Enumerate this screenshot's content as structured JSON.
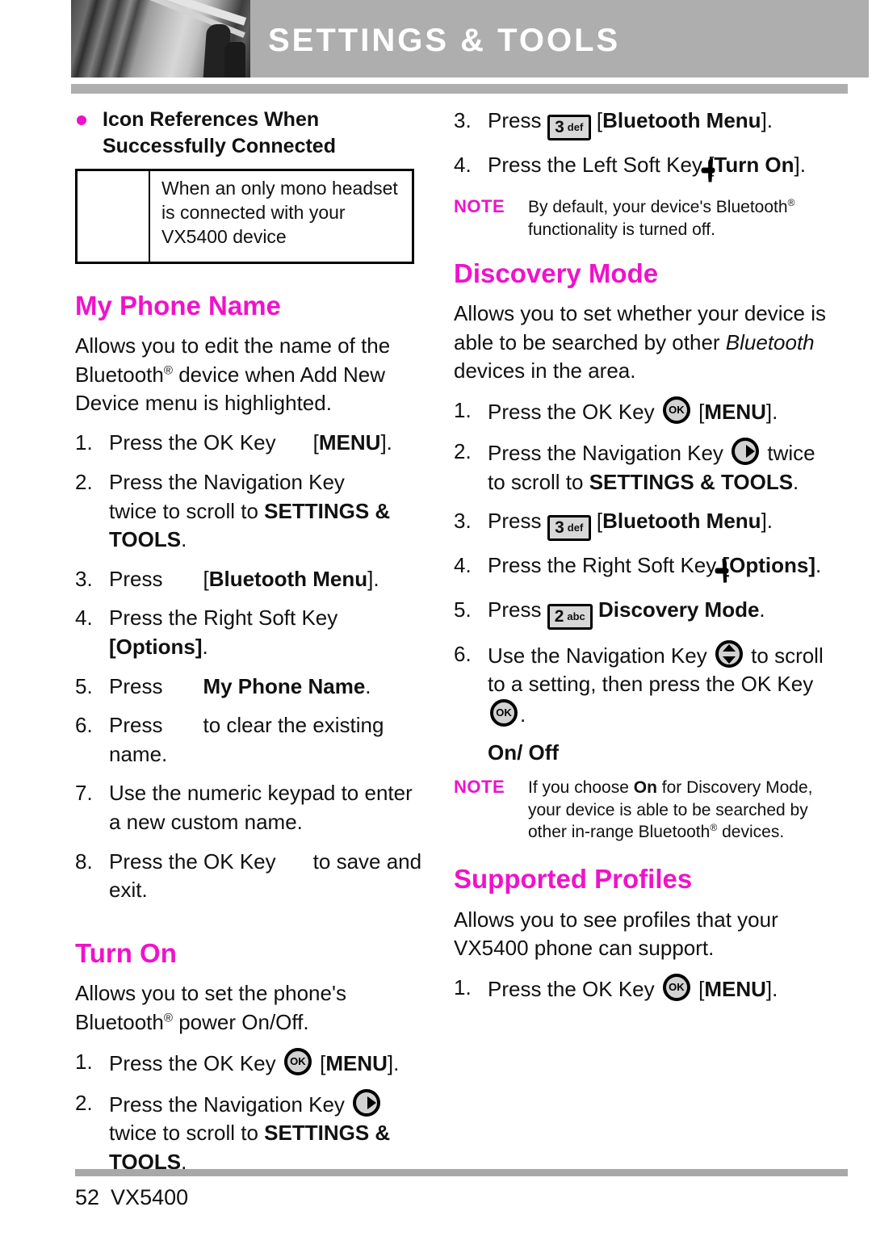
{
  "header": {
    "title": "SETTINGS & TOOLS",
    "photo_alt": "grayscale-architecture-photo"
  },
  "left_column": {
    "icon_ref": {
      "heading_line1": "Icon References When",
      "heading_line2": "Successfully Connected",
      "table": {
        "icon_cell": "",
        "description": "When an only mono headset is connected with your VX5400 device"
      }
    },
    "my_phone_name": {
      "title": "My Phone Name",
      "description": "Allows you to edit the name of the Bluetooth® device when Add New Device menu is highlighted.",
      "steps": [
        {
          "num": "1.",
          "pre": "Press the OK Key",
          "icon": "",
          "post": "[MENU].",
          "post_bold": "MENU"
        },
        {
          "num": "2.",
          "pre": "Press the Navigation Key",
          "icon": "",
          "post": "twice to scroll to SETTINGS & TOOLS.",
          "post_bold": "SETTINGS & TOOLS"
        },
        {
          "num": "3.",
          "pre": "Press",
          "icon": "",
          "post": "[Bluetooth Menu].",
          "post_bold": "Bluetooth Menu"
        },
        {
          "num": "4.",
          "pre": "Press the Right Soft Key",
          "icon": "",
          "post": "[Options].",
          "post_bold": "Options"
        },
        {
          "num": "5.",
          "pre": "Press",
          "icon": "",
          "post": "My Phone Name.",
          "post_bold": "My Phone Name"
        },
        {
          "num": "6.",
          "pre": "Press",
          "icon": "",
          "post": "to clear the existing name.",
          "post_bold": ""
        },
        {
          "num": "7.",
          "pre": "Use the numeric keypad to enter a new custom name.",
          "icon": "",
          "post": "",
          "post_bold": ""
        },
        {
          "num": "8.",
          "pre": "Press the OK Key",
          "icon": "",
          "post": "to save and exit.",
          "post_bold": ""
        }
      ]
    },
    "turn_on": {
      "title": "Turn On",
      "description": "Allows you to set the phone's Bluetooth® power On/Off.",
      "steps": [
        {
          "num": "1.",
          "pre": "Press the OK Key",
          "icon": "ok-key-icon",
          "post": "[MENU].",
          "post_bold": "MENU"
        },
        {
          "num": "2.",
          "pre": "Press the Navigation Key",
          "icon": "navigation-key-right-icon",
          "post": "twice to scroll to SETTINGS & TOOLS.",
          "post_bold": "SETTINGS & TOOLS"
        }
      ]
    }
  },
  "right_column": {
    "turn_on_cont": {
      "steps": [
        {
          "num": "3.",
          "pre": "Press",
          "icon": "key-3-def-icon",
          "icon_digit": "3",
          "icon_letters": "def",
          "post": "[Bluetooth Menu].",
          "post_bold": "Bluetooth Menu"
        },
        {
          "num": "4.",
          "pre": "Press the Left Soft Key",
          "icon": "left-soft-key-icon",
          "post": "[Turn On].",
          "post_bold": "Turn On"
        }
      ],
      "note": {
        "label": "NOTE",
        "text": "By default, your device's Bluetooth® functionality is turned off."
      }
    },
    "discovery_mode": {
      "title": "Discovery Mode",
      "description": "Allows you to set whether your device is able to be searched by other Bluetooth devices in the area.",
      "description_italic_word": "Bluetooth",
      "steps": [
        {
          "num": "1.",
          "pre": "Press the OK Key",
          "icon": "ok-key-icon",
          "post": "[MENU].",
          "post_bold": "MENU"
        },
        {
          "num": "2.",
          "pre": "Press the Navigation Key",
          "icon": "navigation-key-right-icon",
          "post": "twice to scroll to SETTINGS & TOOLS.",
          "post_bold": "SETTINGS & TOOLS"
        },
        {
          "num": "3.",
          "pre": "Press",
          "icon": "key-3-def-icon",
          "icon_digit": "3",
          "icon_letters": "def",
          "post": "[Bluetooth Menu].",
          "post_bold": "Bluetooth Menu"
        },
        {
          "num": "4.",
          "pre": "Press the Right Soft Key",
          "icon": "right-soft-key-icon",
          "post": "[Options].",
          "post_bold": "Options"
        },
        {
          "num": "5.",
          "pre": "Press",
          "icon": "key-2-abc-icon",
          "icon_digit": "2",
          "icon_letters": "abc",
          "post": "Discovery Mode.",
          "post_bold": "Discovery Mode"
        },
        {
          "num": "6.",
          "pre": "Use the Navigation Key",
          "icon": "navigation-key-updown-icon",
          "post": "to scroll to a setting, then press the OK Key",
          "post_bold": ""
        }
      ],
      "subheading": "On/ Off",
      "note": {
        "label": "NOTE",
        "text": "If you choose On for Discovery Mode, your device is able to be searched by other in-range Bluetooth® devices.",
        "bold_word": "On"
      }
    },
    "supported_profiles": {
      "title": "Supported Profiles",
      "description": "Allows you to see profiles that your VX5400 phone can support.",
      "steps": [
        {
          "num": "1.",
          "pre": "Press the OK Key",
          "icon": "ok-key-icon",
          "post": "[MENU].",
          "post_bold": "MENU"
        }
      ]
    }
  },
  "footer": {
    "page_number": "52",
    "model": "VX5400"
  },
  "colors": {
    "accent_magenta": "#f012ca",
    "header_gray": "#aeaeae",
    "key_fill": "#d2d2d2"
  }
}
